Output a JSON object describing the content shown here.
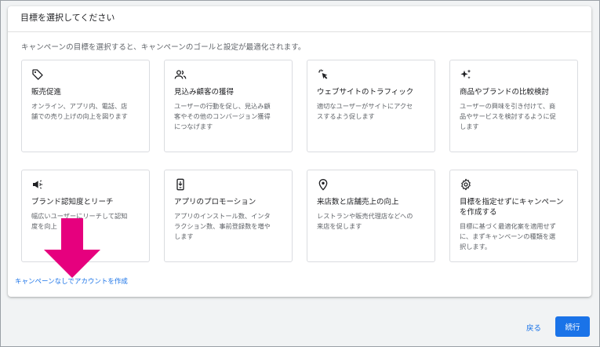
{
  "dialog": {
    "header": "目標を選択してください",
    "subtitle": "キャンペーンの目標を選択すると、キャンペーンのゴールと設定が最適化されます。"
  },
  "goals": [
    {
      "icon": "tag-icon",
      "title": "販売促進",
      "desc_lines": [
        "オンライン、アプリ内、電話、店",
        "舗での売り上げの向上を図ります"
      ]
    },
    {
      "icon": "people-icon",
      "title": "見込み顧客の獲得",
      "desc_lines": [
        "ユーザーの行動を促し、見込み顧",
        "客やその他のコンバージョン獲得",
        "につなげます"
      ]
    },
    {
      "icon": "cursor-click-icon",
      "title": "ウェブサイトのトラフィック",
      "desc_lines": [
        "適切なユーザーがサイトにアクセ",
        "スするよう促します"
      ]
    },
    {
      "icon": "sparkle-icon",
      "title": "商品やブランドの比較検討",
      "desc_lines": [
        "ユーザーの興味を引き付けて、商",
        "品やサービスを検討するように促",
        "します"
      ]
    },
    {
      "icon": "megaphone-icon",
      "title": "ブランド認知度とリーチ",
      "desc_lines": [
        "幅広いユーザーにリーチして認知",
        "度を向上"
      ]
    },
    {
      "icon": "phone-download-icon",
      "title": "アプリのプロモーション",
      "desc_lines": [
        "アプリのインストール数、インタ",
        "ラクション数、事前登録数を増や",
        "します"
      ]
    },
    {
      "icon": "location-pin-icon",
      "title": "来店数と店舗売上の向上",
      "desc_lines": [
        "レストランや販売代理店などへの",
        "来店を促します"
      ]
    },
    {
      "icon": "gear-icon",
      "title_lines": [
        "目標を指定せずにキャンペーン",
        "を作成する"
      ],
      "desc_lines": [
        "目標に基づく最適化案を適用せず",
        "に、まずキャンペーンの種類を選",
        "択します。"
      ]
    }
  ],
  "links": {
    "no_campaign": "キャンペーンなしでアカウントを作成"
  },
  "footer": {
    "back": "戻る",
    "continue": "続行"
  },
  "colors": {
    "accent": "#1a73e8",
    "arrow": "#e6007e"
  }
}
